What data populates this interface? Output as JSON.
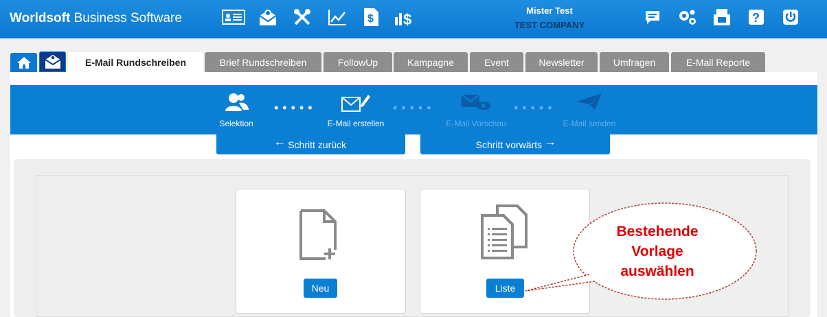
{
  "app": {
    "brand_bold": "Worldsoft",
    "brand_rest": " Business Software"
  },
  "header_icons": [
    "contact-card-icon",
    "mail-settings-icon",
    "tools-icon",
    "chart-icon",
    "invoice-icon",
    "revenue-icon"
  ],
  "user": {
    "name": "Mister Test",
    "company": "TEST COMPANY"
  },
  "header_right_icons": [
    "chat-icon",
    "settings-icon",
    "fax-icon",
    "help-icon",
    "power-icon"
  ],
  "tabs": [
    {
      "label": "E-Mail Rundschreiben",
      "active": true
    },
    {
      "label": "Brief Rundschreiben"
    },
    {
      "label": "FollowUp"
    },
    {
      "label": "Kampagne"
    },
    {
      "label": "Event"
    },
    {
      "label": "Newsletter"
    },
    {
      "label": "Umfragen"
    },
    {
      "label": "E-Mail Reporte"
    }
  ],
  "wizard": {
    "steps": [
      {
        "label": "Selektion",
        "icon": "users-icon",
        "active": true
      },
      {
        "label": "E-Mail erstellen",
        "icon": "mail-edit-icon",
        "active": true
      },
      {
        "label": "E-Mail Vorschau",
        "icon": "mail-preview-icon",
        "active": false
      },
      {
        "label": "E-Mail senden",
        "icon": "send-icon",
        "active": false
      }
    ],
    "back": "Schritt zurück",
    "forward": "Schritt vorwärts"
  },
  "cards": {
    "new_label": "Neu",
    "list_label": "Liste"
  },
  "callout": {
    "line1": "Bestehende",
    "line2": "Vorlage",
    "line3": "auswählen"
  },
  "colors": {
    "accent": "#0a7fd4",
    "tab_inactive": "#8e8e8e",
    "callout_text": "#e00000"
  }
}
